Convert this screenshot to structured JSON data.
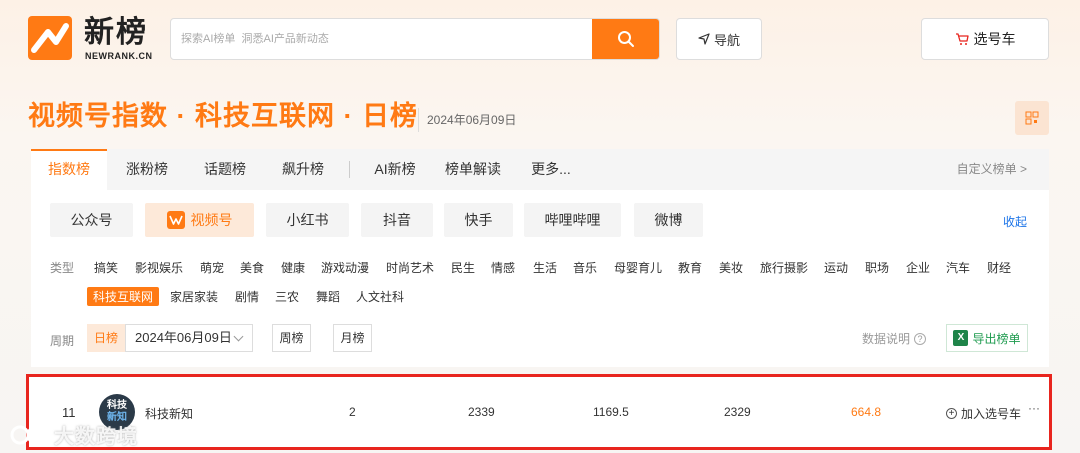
{
  "brand": {
    "name": "新榜",
    "sub": "NEWRANK.CN"
  },
  "search": {
    "placeholder": "探索AI榜单  洞悉AI产品新动态"
  },
  "header": {
    "nav_label": "导航",
    "cart_label": "选号车"
  },
  "page": {
    "title": "视频号指数 · 科技互联网 · 日榜",
    "date": "2024年06月09日"
  },
  "tabs": [
    {
      "label": "指数榜",
      "active": true
    },
    {
      "label": "涨粉榜"
    },
    {
      "label": "话题榜"
    },
    {
      "label": "飙升榜"
    },
    {
      "label": "AI新榜"
    },
    {
      "label": "榜单解读"
    },
    {
      "label": "更多..."
    }
  ],
  "custom_link": "自定义榜单 >",
  "platforms": [
    {
      "label": "公众号"
    },
    {
      "label": "视频号",
      "active": true
    },
    {
      "label": "小红书"
    },
    {
      "label": "抖音"
    },
    {
      "label": "快手"
    },
    {
      "label": "哔哩哔哩"
    },
    {
      "label": "微博"
    }
  ],
  "collapse_label": "收起",
  "categories": {
    "label": "类型",
    "row1": [
      "搞笑",
      "影视娱乐",
      "萌宠",
      "美食",
      "健康",
      "游戏动漫",
      "时尚艺术",
      "民生",
      "情感",
      "生活",
      "音乐",
      "母婴育儿",
      "教育",
      "美妆",
      "旅行摄影",
      "运动",
      "职场",
      "企业",
      "汽车",
      "财经"
    ],
    "row2": [
      "科技互联网",
      "家居家装",
      "剧情",
      "三农",
      "舞蹈",
      "人文社科"
    ],
    "active": "科技互联网"
  },
  "period": {
    "label": "周期",
    "day": "日榜",
    "date_value": "2024年06月09日",
    "week": "周榜",
    "month": "月榜",
    "data_note": "数据说明",
    "export": "导出榜单"
  },
  "row": {
    "rank": "11",
    "avatar_text": [
      "科技",
      "新知"
    ],
    "account": "科技新知",
    "c1": "2",
    "c2": "2339",
    "c3": "1169.5",
    "c4": "2329",
    "c5": "664.8",
    "add": "加入选号车",
    "more": "···"
  },
  "watermark": "大数跨境",
  "colors": {
    "accent": "#ff7a14",
    "highlight_border": "#e8251e",
    "export_green": "#1e9b4f"
  }
}
